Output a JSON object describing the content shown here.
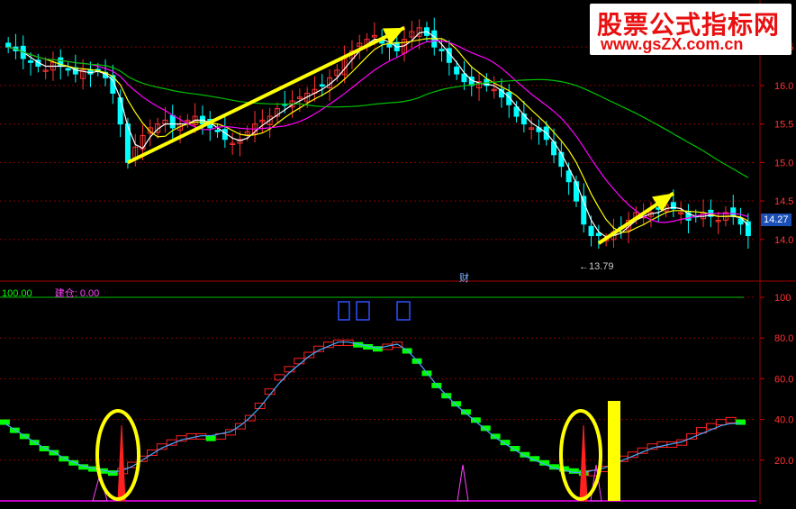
{
  "watermark": {
    "title": "股票公式指标网",
    "url": "www.gsZX.com.cn"
  },
  "upper_panel": {
    "y_ticks": [
      "16.5",
      "16.0",
      "15.5",
      "15.0",
      "14.5",
      "14.0"
    ],
    "last_price_tag": "14.27",
    "low_label": "13.79",
    "event_flag": "财"
  },
  "lower_panel": {
    "legend_a": "100.00",
    "legend_b": "建仓: 0.00",
    "y_ticks": [
      "100",
      "80.0",
      "60.0",
      "40.0",
      "20.0"
    ]
  },
  "colors": {
    "up_candle": "#ff3232",
    "down_candle": "#00ffff",
    "ma_short": "#ffffff",
    "ma_mid": "#ffff00",
    "ma_long": "#ff00ff",
    "ma_slow": "#00c000",
    "arrow": "#ffff00",
    "step_up": "#ff2020",
    "step_down": "#00ff00",
    "signal_line": "#4aa8ff",
    "grid": "#8b0000"
  },
  "chart_data": [
    {
      "type": "candlestick",
      "title": "",
      "y_range": [
        13.6,
        16.9
      ],
      "series": [
        {
          "name": "price",
          "values": [
            16.5,
            16.45,
            16.35,
            16.3,
            16.25,
            16.2,
            16.3,
            16.25,
            16.2,
            16.15,
            16.2,
            16.15,
            16.2,
            16.1,
            15.9,
            15.5,
            15.0,
            15.2,
            15.35,
            15.45,
            15.5,
            15.55,
            15.45,
            15.5,
            15.55,
            15.6,
            15.5,
            15.45,
            15.4,
            15.3,
            15.25,
            15.3,
            15.4,
            15.5,
            15.55,
            15.6,
            15.7,
            15.75,
            15.8,
            15.85,
            15.9,
            15.95,
            16.0,
            16.1,
            16.2,
            16.35,
            16.45,
            16.55,
            16.6,
            16.65,
            16.55,
            16.5,
            16.45,
            16.6,
            16.7,
            16.75,
            16.65,
            16.5,
            16.45,
            16.3,
            16.15,
            16.05,
            16.0,
            16.05,
            16.0,
            15.95,
            15.85,
            15.75,
            15.6,
            15.5,
            15.45,
            15.4,
            15.3,
            15.1,
            14.95,
            14.75,
            14.5,
            14.2,
            14.05,
            14.05,
            14.0,
            14.1,
            14.15,
            14.25,
            14.35,
            14.3,
            14.35,
            14.4,
            14.45,
            14.4,
            14.35,
            14.25,
            14.3,
            14.35,
            14.3,
            14.25,
            14.35,
            14.3,
            14.2,
            14.05
          ]
        }
      ],
      "y_ticks": [
        14.0,
        14.5,
        15.0,
        15.5,
        16.0,
        16.5
      ],
      "annotations": [
        "13.79",
        "14.27",
        "财"
      ]
    },
    {
      "type": "line",
      "title": "",
      "y_range": [
        0,
        100
      ],
      "series": [
        {
          "name": "",
          "values": [
            40,
            36,
            33,
            30,
            27,
            25,
            22,
            20,
            18,
            17,
            16,
            15,
            16,
            19,
            22,
            25,
            28,
            30,
            32,
            33,
            33,
            32,
            33,
            35,
            38,
            42,
            48,
            55,
            62,
            66,
            70,
            73,
            76,
            78,
            79,
            79,
            78,
            77,
            76,
            77,
            78,
            75,
            70,
            64,
            58,
            53,
            49,
            45,
            41,
            37,
            33,
            30,
            27,
            24,
            22,
            20,
            18,
            17,
            16,
            15,
            15,
            17,
            20,
            22,
            24,
            26,
            28,
            29,
            29,
            30,
            33,
            36,
            38,
            40,
            41,
            40
          ]
        },
        {
          "name": "",
          "values": [
            38,
            35,
            32,
            29,
            26,
            24,
            21,
            19,
            17,
            16,
            15,
            14,
            15,
            17,
            20,
            23,
            26,
            28,
            30,
            31,
            32,
            32,
            33,
            34,
            37,
            41,
            46,
            52,
            58,
            63,
            67,
            71,
            74,
            76,
            78,
            78,
            77,
            76,
            75,
            76,
            77,
            74,
            69,
            63,
            57,
            52,
            47,
            43,
            39,
            35,
            31,
            28,
            25,
            22,
            20,
            18,
            16,
            15,
            14,
            14,
            15,
            16,
            18,
            20,
            22,
            24,
            26,
            27,
            28,
            29,
            31,
            33,
            35,
            37,
            38,
            38
          ]
        }
      ],
      "y_ticks": [
        20,
        40,
        60,
        80,
        100
      ]
    }
  ]
}
